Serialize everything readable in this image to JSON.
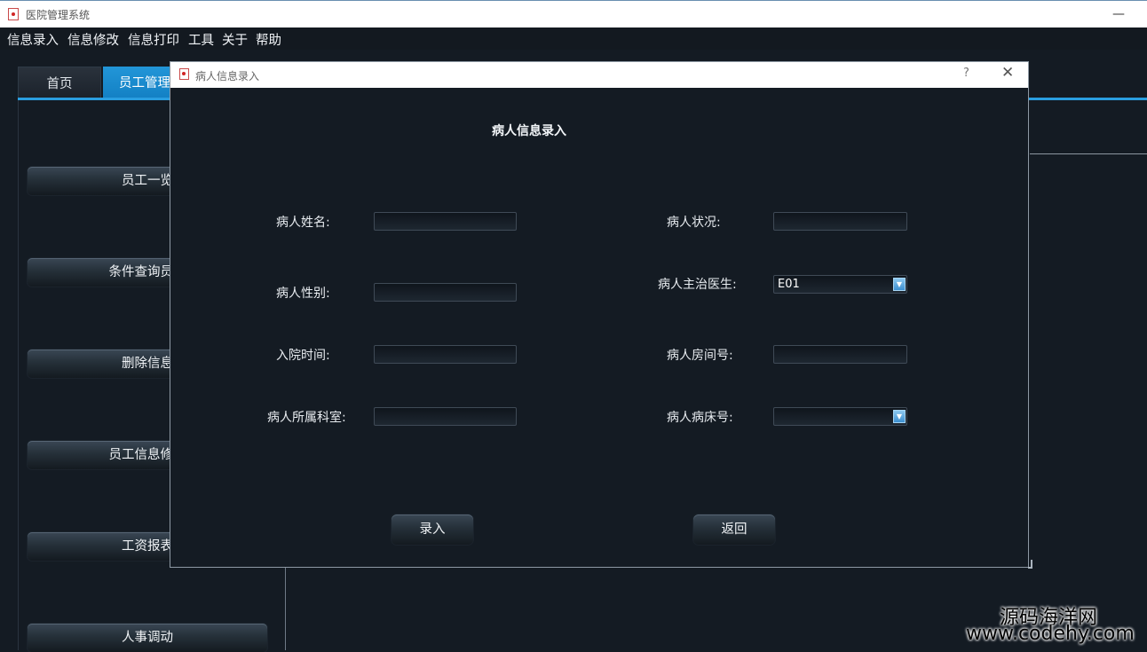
{
  "window": {
    "title": "医院管理系统",
    "minimize_glyph": "—"
  },
  "menu": [
    "信息录入",
    "信息修改",
    "信息打印",
    "工具",
    "关于",
    "帮助"
  ],
  "tabs": {
    "home": "首页",
    "staff": "员工管理"
  },
  "sidebar": {
    "buttons": [
      "员工一览",
      "条件查询员工",
      "删除信息",
      "员工信息修改",
      "工资报表",
      "人事调动"
    ]
  },
  "dialog": {
    "title": "病人信息录入",
    "help_glyph": "?",
    "close_glyph": "✕",
    "heading": "病人信息录入",
    "fields": {
      "name_label": "病人姓名:",
      "gender_label": "病人性别:",
      "admit_label": "入院时间:",
      "dept_label": "病人所属科室:",
      "status_label": "病人状况:",
      "doctor_label": "病人主治医生:",
      "doctor_value": "E01",
      "room_label": "病人房间号:",
      "bed_label": "病人病床号:",
      "bed_value": ""
    },
    "submit_label": "录入",
    "back_label": "返回"
  },
  "icons": {
    "app": "hospital-app-icon",
    "dropdown": "chevron-down-icon"
  },
  "colors": {
    "accent": "#1e8fd2",
    "background": "#141b23"
  },
  "watermark": {
    "cn": "源码海洋网",
    "url": "www.codehy.com"
  }
}
